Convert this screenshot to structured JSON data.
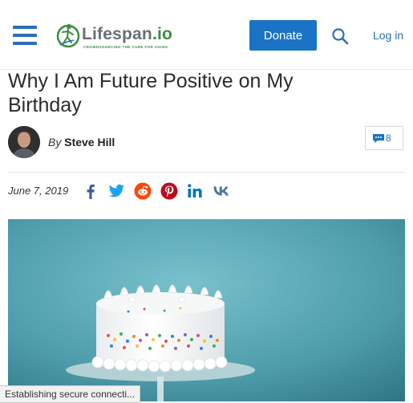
{
  "header": {
    "logo_name": "Lifespan",
    "logo_suffix": ".io",
    "logo_tagline": "CROWDSOURCING THE CURE FOR AGING",
    "donate_label": "Donate",
    "login_label": "Log in",
    "icons": [
      "menu-icon",
      "search-icon"
    ]
  },
  "article": {
    "title": "Why I Am Future Positive on My Birthday",
    "byline_prefix": "By",
    "author": "Steve Hill",
    "comment_count": "8",
    "date": "June 7, 2019",
    "share_icons": [
      "facebook-icon",
      "twitter-icon",
      "reddit-icon",
      "pinterest-icon",
      "linkedin-icon",
      "vk-icon"
    ]
  },
  "colors": {
    "brand_blue": "#1b73c6",
    "logo_green": "#3a8d3f",
    "facebook": "#3b5998",
    "twitter": "#1da1f2",
    "reddit": "#ff4500",
    "pinterest": "#bd081c",
    "linkedin": "#0077b5",
    "vk": "#4c75a3"
  },
  "status_bar": {
    "text": "Establishing secure connecti..."
  }
}
